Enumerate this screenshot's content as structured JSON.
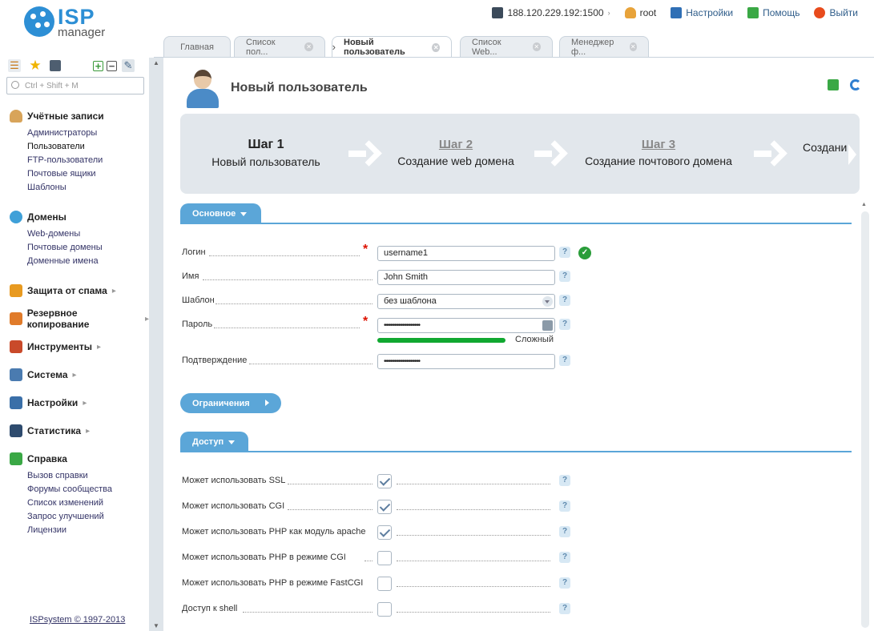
{
  "header": {
    "logo_text": "ISP",
    "logo_sub": "manager",
    "ip": "188.120.229.192:1500",
    "user": "root",
    "settings_label": "Настройки",
    "help_label": "Помощь",
    "logout_label": "Выйти"
  },
  "tabs": [
    {
      "label": "Главная",
      "active": false,
      "closable": false
    },
    {
      "label": "Список пол...",
      "active": false,
      "closable": true
    },
    {
      "label": "Новый пользователь",
      "active": true,
      "closable": true
    },
    {
      "label": "Список Web...",
      "active": false,
      "closable": true
    },
    {
      "label": "Менеджер ф...",
      "active": false,
      "closable": true
    }
  ],
  "search": {
    "placeholder": "Ctrl + Shift + M"
  },
  "sidebar": {
    "groups": [
      {
        "title": "Учётные записи",
        "icon": "user-icon",
        "items": [
          "Администраторы",
          "Пользователи",
          "FTP-пользователи",
          "Почтовые ящики",
          "Шаблоны"
        ]
      },
      {
        "title": "Домены",
        "icon": "globe-icon",
        "items": [
          "Web-домены",
          "Почтовые домены",
          "Доменные имена"
        ]
      },
      {
        "title": "Защита от спама",
        "icon": "shield-icon",
        "items": []
      },
      {
        "title": "Резервное копирование",
        "icon": "backup-icon",
        "items": []
      },
      {
        "title": "Инструменты",
        "icon": "tools-icon",
        "items": []
      },
      {
        "title": "Система",
        "icon": "system-icon",
        "items": []
      },
      {
        "title": "Настройки",
        "icon": "settings-icon",
        "items": []
      },
      {
        "title": "Статистика",
        "icon": "stats-icon",
        "items": []
      },
      {
        "title": "Справка",
        "icon": "help-book-icon",
        "items": [
          "Вызов справки",
          "Форумы сообщества",
          "Список изменений",
          "Запрос улучшений",
          "Лицензии"
        ]
      }
    ],
    "copyright": "ISPsystem © 1997-2013"
  },
  "page": {
    "title": "Новый пользователь"
  },
  "wizard": {
    "steps": [
      {
        "num": "Шаг 1",
        "label": "Новый пользователь",
        "current": true
      },
      {
        "num": "Шаг 2",
        "label": "Создание web домена",
        "current": false
      },
      {
        "num": "Шаг 3",
        "label": "Создание почтового домена",
        "current": false
      },
      {
        "num": "",
        "label": "Создани",
        "current": false
      }
    ]
  },
  "section_main": {
    "title": "Основное",
    "fields": {
      "login": {
        "label": "Логин",
        "value": "username1"
      },
      "name": {
        "label": "Имя",
        "value": "John Smith"
      },
      "template": {
        "label": "Шаблон",
        "value": "без шаблона"
      },
      "password": {
        "label": "Пароль",
        "value": "••••••••••••••••••"
      },
      "confirm": {
        "label": "Подтверждение",
        "value": "••••••••••••••••••"
      }
    },
    "strength_label": "Сложный",
    "help_glyph": "?"
  },
  "limits_button": "Ограничения",
  "section_access": {
    "title": "Доступ",
    "options": [
      {
        "label": "Может использовать SSL",
        "checked": true
      },
      {
        "label": "Может использовать CGI",
        "checked": true
      },
      {
        "label": "Может использовать PHP как модуль apache",
        "checked": true
      },
      {
        "label": "Может использовать PHP в режиме CGI",
        "checked": false
      },
      {
        "label": "Может использовать PHP в режиме FastCGI",
        "checked": false
      },
      {
        "label": "Доступ к shell",
        "checked": false
      }
    ]
  },
  "colors": {
    "accent": "#5ba6d8",
    "logo": "#2d8fd5",
    "strength": "#10a830",
    "required": "#dd1100"
  }
}
